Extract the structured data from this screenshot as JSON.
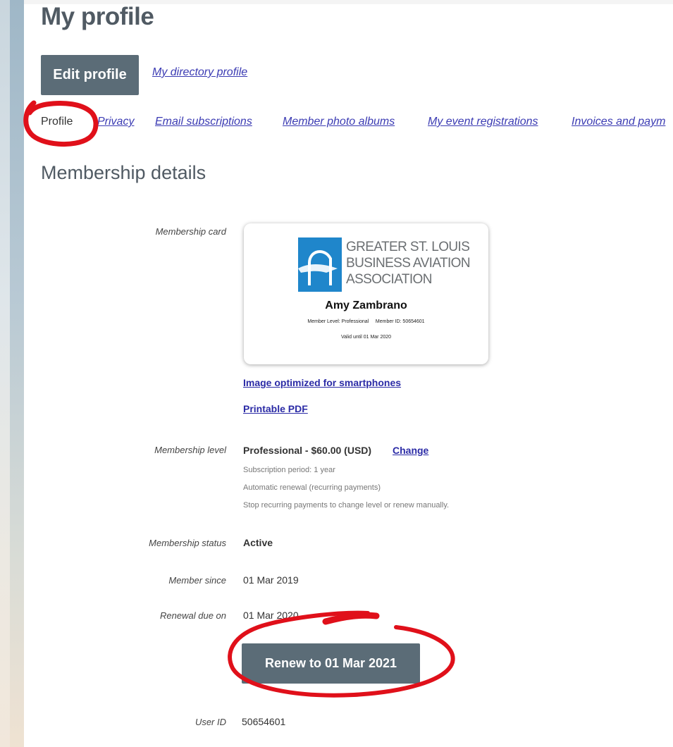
{
  "page": {
    "title": "My profile"
  },
  "actions": {
    "edit_label": "Edit profile",
    "directory_link": "My directory profile"
  },
  "tabs": [
    {
      "label": "Profile",
      "active": true
    },
    {
      "label": "Privacy"
    },
    {
      "label": "Email subscriptions"
    },
    {
      "label": "Member photo albums"
    },
    {
      "label": "My event registrations"
    },
    {
      "label": "Invoices and paym"
    }
  ],
  "section": {
    "title": "Membership details"
  },
  "card": {
    "label": "Membership card",
    "org_line1": "GREATER ST. LOUIS",
    "org_line2": "BUSINESS AVIATION",
    "org_line3": "ASSOCIATION",
    "member_name": "Amy Zambrano",
    "member_level": "Member Level: Professional",
    "member_id": "Member ID: 50654601",
    "valid_until": "Valid until 01 Mar 2020",
    "link_smartphone": "Image optimized for smartphones",
    "link_pdf": "Printable PDF"
  },
  "level": {
    "label": "Membership level",
    "value": "Professional - $60.00 (USD)",
    "change_link": "Change",
    "notes": [
      "Subscription period: 1 year",
      "Automatic renewal (recurring payments)",
      "Stop recurring payments to change level or renew manually."
    ]
  },
  "status": {
    "label": "Membership status",
    "value": "Active"
  },
  "since": {
    "label": "Member since",
    "value": "01 Mar 2019"
  },
  "renewal": {
    "label": "Renewal due on",
    "value": "01 Mar 2020",
    "button_label": "Renew to 01 Mar 2021"
  },
  "user": {
    "label": "User ID",
    "value": "50654601"
  },
  "colors": {
    "button": "#5b6c77",
    "link": "#3b3bb3",
    "logo_blue": "#1f86cb",
    "annotation_red": "#e0101a"
  }
}
